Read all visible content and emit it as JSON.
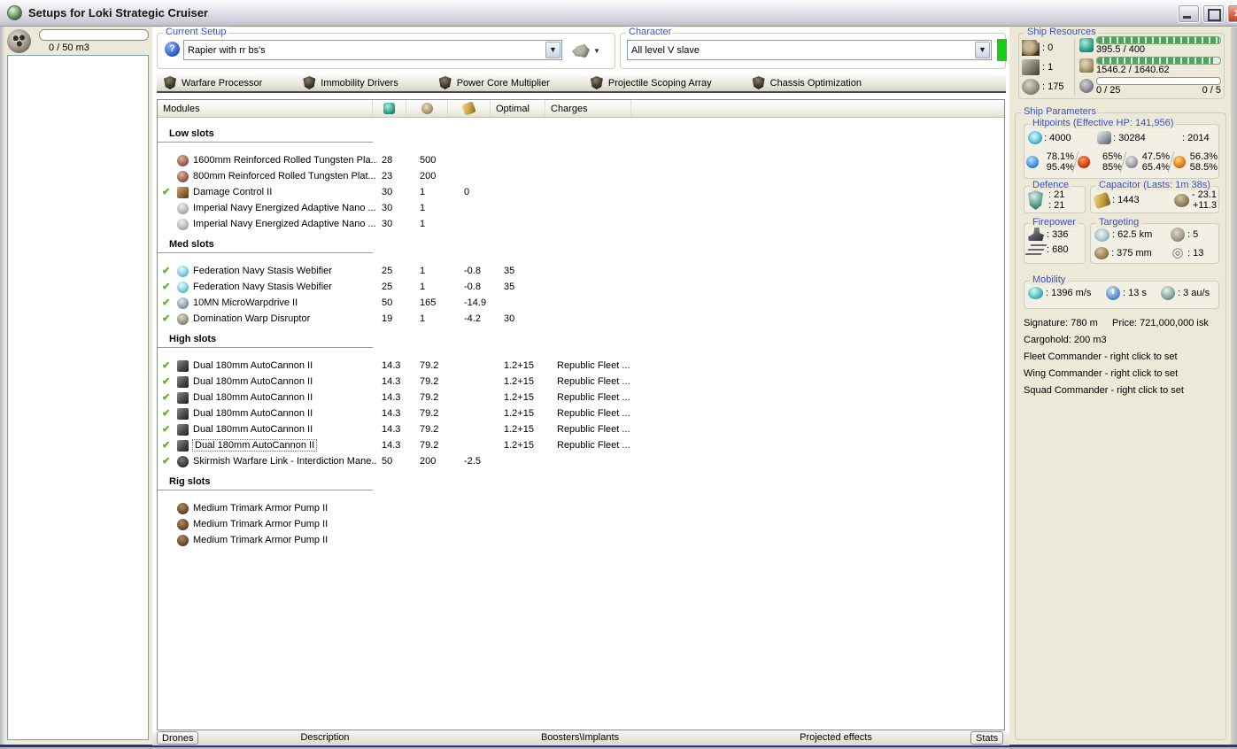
{
  "window": {
    "title": "Setups for Loki Strategic Cruiser"
  },
  "drone_panel": {
    "capacity_label": "0 / 50 m3"
  },
  "setup_group": {
    "caption": "Current Setup",
    "value": "Rapier with rr bs's",
    "help_icon": "help-icon",
    "tools_icon": "setup-tools-icon"
  },
  "character_group": {
    "caption": "Character",
    "value": "All level V slave"
  },
  "subsystems": [
    {
      "icon": "subsystem-icon",
      "label": "Warfare Processor"
    },
    {
      "icon": "subsystem-icon",
      "label": "Immobility Drivers"
    },
    {
      "icon": "subsystem-icon",
      "label": "Power Core Multiplier"
    },
    {
      "icon": "subsystem-icon",
      "label": "Projectile Scoping Array"
    },
    {
      "icon": "subsystem-icon",
      "label": "Chassis Optimization"
    }
  ],
  "module_table": {
    "header": {
      "modules": "Modules",
      "cpu_icon": "cpu-icon",
      "powergrid_icon": "powergrid-icon",
      "capacitor_icon": "capacitor-icon",
      "optimal": "Optimal",
      "charges": "Charges"
    },
    "sections": [
      {
        "title": "Low slots",
        "rows": [
          {
            "fitted": false,
            "icon": "armor-plate-icon",
            "name": "1600mm Reinforced Rolled Tungsten Pla...",
            "cpu": "28",
            "pg": "500",
            "cap": "",
            "optimal": "",
            "charges": ""
          },
          {
            "fitted": false,
            "icon": "armor-plate-icon",
            "name": "800mm Reinforced Rolled Tungsten Plat...",
            "cpu": "23",
            "pg": "200",
            "cap": "",
            "optimal": "",
            "charges": ""
          },
          {
            "fitted": true,
            "icon": "damage-control-icon",
            "name": "Damage Control II",
            "cpu": "30",
            "pg": "1",
            "cap": "0",
            "optimal": "",
            "charges": ""
          },
          {
            "fitted": false,
            "icon": "energized-membrane-icon",
            "name": "Imperial Navy Energized Adaptive Nano ...",
            "cpu": "30",
            "pg": "1",
            "cap": "",
            "optimal": "",
            "charges": ""
          },
          {
            "fitted": false,
            "icon": "energized-membrane-icon",
            "name": "Imperial Navy Energized Adaptive Nano ...",
            "cpu": "30",
            "pg": "1",
            "cap": "",
            "optimal": "",
            "charges": ""
          }
        ]
      },
      {
        "title": "Med slots",
        "rows": [
          {
            "fitted": true,
            "icon": "webifier-icon",
            "name": "Federation Navy Stasis Webifier",
            "cpu": "25",
            "pg": "1",
            "cap": "-0.8",
            "optimal": "35",
            "charges": ""
          },
          {
            "fitted": true,
            "icon": "webifier-icon",
            "name": "Federation Navy Stasis Webifier",
            "cpu": "25",
            "pg": "1",
            "cap": "-0.8",
            "optimal": "35",
            "charges": ""
          },
          {
            "fitted": true,
            "icon": "mwd-icon",
            "name": "10MN MicroWarpdrive II",
            "cpu": "50",
            "pg": "165",
            "cap": "-14.9",
            "optimal": "",
            "charges": ""
          },
          {
            "fitted": true,
            "icon": "warp-disruptor-icon",
            "name": "Domination Warp Disruptor",
            "cpu": "19",
            "pg": "1",
            "cap": "-4.2",
            "optimal": "30",
            "charges": ""
          }
        ]
      },
      {
        "title": "High slots",
        "rows": [
          {
            "fitted": true,
            "icon": "autocannon-icon",
            "name": "Dual 180mm AutoCannon II",
            "cpu": "14.3",
            "pg": "79.2",
            "cap": "",
            "optimal": "1.2+15",
            "charges": "Republic Fleet ..."
          },
          {
            "fitted": true,
            "icon": "autocannon-icon",
            "name": "Dual 180mm AutoCannon II",
            "cpu": "14.3",
            "pg": "79.2",
            "cap": "",
            "optimal": "1.2+15",
            "charges": "Republic Fleet ..."
          },
          {
            "fitted": true,
            "icon": "autocannon-icon",
            "name": "Dual 180mm AutoCannon II",
            "cpu": "14.3",
            "pg": "79.2",
            "cap": "",
            "optimal": "1.2+15",
            "charges": "Republic Fleet ..."
          },
          {
            "fitted": true,
            "icon": "autocannon-icon",
            "name": "Dual 180mm AutoCannon II",
            "cpu": "14.3",
            "pg": "79.2",
            "cap": "",
            "optimal": "1.2+15",
            "charges": "Republic Fleet ..."
          },
          {
            "fitted": true,
            "icon": "autocannon-icon",
            "name": "Dual 180mm AutoCannon II",
            "cpu": "14.3",
            "pg": "79.2",
            "cap": "",
            "optimal": "1.2+15",
            "charges": "Republic Fleet ..."
          },
          {
            "fitted": true,
            "icon": "autocannon-icon",
            "name": "Dual 180mm AutoCannon II",
            "cpu": "14.3",
            "pg": "79.2",
            "cap": "",
            "optimal": "1.2+15",
            "charges": "Republic Fleet ...",
            "focused": true
          },
          {
            "fitted": true,
            "icon": "warfare-link-icon",
            "name": "Skirmish Warfare Link - Interdiction Mane...",
            "cpu": "50",
            "pg": "200",
            "cap": "-2.5",
            "optimal": "",
            "charges": ""
          }
        ]
      },
      {
        "title": "Rig slots",
        "rows": [
          {
            "fitted": false,
            "icon": "rig-pump-icon",
            "name": "Medium Trimark Armor Pump II",
            "cpu": "",
            "pg": "",
            "cap": "",
            "optimal": "",
            "charges": ""
          },
          {
            "fitted": false,
            "icon": "rig-pump-icon",
            "name": "Medium Trimark Armor Pump II",
            "cpu": "",
            "pg": "",
            "cap": "",
            "optimal": "",
            "charges": ""
          },
          {
            "fitted": false,
            "icon": "rig-pump-icon",
            "name": "Medium Trimark Armor Pump II",
            "cpu": "",
            "pg": "",
            "cap": "",
            "optimal": "",
            "charges": ""
          }
        ]
      }
    ]
  },
  "bottom_tabs": [
    {
      "label": "Drones",
      "style": "button"
    },
    {
      "label": "Description",
      "style": "flat"
    },
    {
      "label": "Boosters\\Implants",
      "style": "flat"
    },
    {
      "label": "Projected effects",
      "style": "flat"
    },
    {
      "label": "Stats",
      "style": "button"
    }
  ],
  "ship_resources": {
    "caption": "Ship Resources",
    "hardpoints": [
      {
        "icon": "turret-hardpoint-icon",
        "value": ": 0"
      },
      {
        "icon": "launcher-hardpoint-icon",
        "value": ": 1"
      },
      {
        "icon": "calibration-icon",
        "value": ": 175"
      }
    ],
    "bars": [
      {
        "icon": "cpu-icon",
        "fill_pct": 99,
        "label": "395.5 / 400",
        "right_label": ""
      },
      {
        "icon": "powergrid-icon",
        "fill_pct": 94,
        "label": "1546.2 / 1640.62",
        "right_label": ""
      },
      {
        "icon": "drone-bandwidth-icon",
        "fill_pct": 0,
        "label": "0 / 25",
        "right_label": "0 / 5"
      }
    ]
  },
  "ship_parameters": {
    "caption": "Ship Parameters",
    "hitpoints": {
      "caption": "Hitpoints (Effective HP: 141,956)",
      "pools": [
        {
          "icon": "shield-hp-icon",
          "value": ": 4000"
        },
        {
          "icon": "armor-hp-icon",
          "value": ": 30284"
        },
        {
          "icon": "structure-hp-icon",
          "value": ": 2014"
        }
      ],
      "resists": [
        {
          "icon": "em-resist-icon",
          "shield": "78.1%",
          "armor": "95.4%"
        },
        {
          "icon": "thermal-resist-icon",
          "shield": "65%",
          "armor": "85%"
        },
        {
          "icon": "kinetic-resist-icon",
          "shield": "47.5%",
          "armor": "65.4%"
        },
        {
          "icon": "explosive-resist-icon",
          "shield": "56.3%",
          "armor": "58.5%"
        }
      ]
    },
    "defence": {
      "caption": "Defence",
      "icon": "defence-shield-icon",
      "line1": ": 21",
      "line2": ": 21"
    },
    "capacitor": {
      "caption": "Capacitor (Lasts: 1m 38s)",
      "icon": "capacitor-charge-icon",
      "amount": ": 1443",
      "drain_icon": "cap-drain-icon",
      "drain_line1": "- 23.1",
      "drain_line2": "+11.3"
    },
    "firepower": {
      "caption": "Firepower",
      "volley_icon": "volley-icon",
      "volley": ": 336",
      "dps_icon": "dps-icon",
      "dps": ": 680"
    },
    "targeting": {
      "caption": "Targeting",
      "range_icon": "targeting-range-icon",
      "range": ": 62.5 km",
      "max_targets_icon": "max-targets-icon",
      "max_targets": ": 5",
      "scan_res_icon": "scan-resolution-icon",
      "scan_res": ": 375 mm",
      "sensor_icon": "sensor-strength-icon",
      "sensor_glyph": "◎",
      "sensor": ": 13"
    },
    "mobility": {
      "caption": "Mobility",
      "speed_icon": "speed-icon",
      "speed": ": 1396 m/s",
      "align_icon": "align-time-icon",
      "align": ": 13 s",
      "warp_icon": "warp-speed-icon",
      "warp": ": 3 au/s"
    },
    "info": {
      "signature": "Signature: 780 m",
      "price": "Price: 721,000,000 isk",
      "cargohold": "Cargohold: 200 m3",
      "fleet": "Fleet Commander - right click to set",
      "wing": "Wing Commander - right click to set",
      "squad": "Squad Commander - right click to set"
    }
  }
}
